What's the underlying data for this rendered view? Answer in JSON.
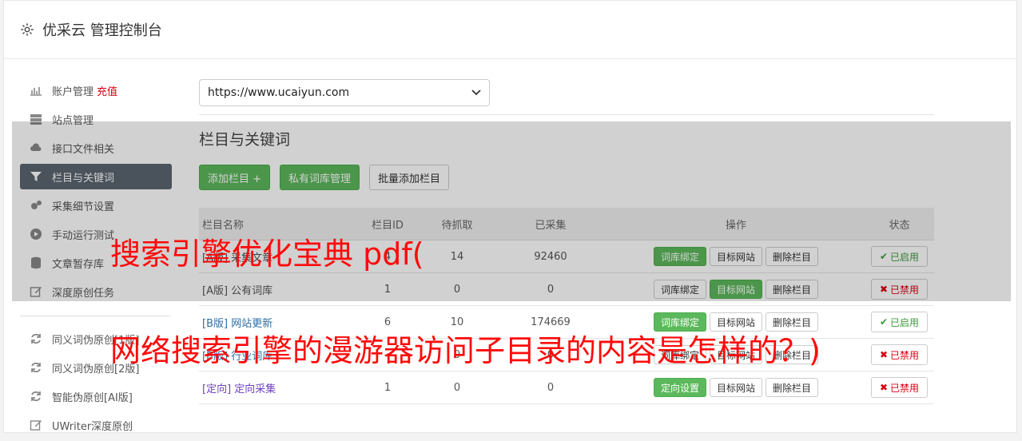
{
  "header": {
    "title": "优采云 管理控制台"
  },
  "sidebar": {
    "items": [
      {
        "label": "账户管理",
        "extra": "充值",
        "icon": "bar-chart-icon"
      },
      {
        "label": "站点管理",
        "icon": "server-icon"
      },
      {
        "label": "接口文件相关",
        "icon": "cloud-upload-icon"
      },
      {
        "label": "栏目与关键词",
        "icon": "filter-icon",
        "active": true
      },
      {
        "label": "采集细节设置",
        "icon": "cogs-icon"
      },
      {
        "label": "手动运行测试",
        "icon": "play-circle-icon"
      },
      {
        "label": "文章暂存库",
        "icon": "database-icon"
      },
      {
        "label": "深度原创任务",
        "icon": "edit-icon"
      }
    ],
    "items2": [
      {
        "label": "同义词伪原创[1版]",
        "icon": "refresh-icon"
      },
      {
        "label": "同义词伪原创[2版]",
        "icon": "refresh-icon"
      },
      {
        "label": "智能伪原创[AI版]",
        "icon": "refresh-icon"
      },
      {
        "label": "UWriter深度原创",
        "icon": "edit-icon"
      }
    ]
  },
  "main": {
    "site_select": "https://www.ucaiyun.com",
    "section_title": "栏目与关键词",
    "buttons": {
      "add": "添加栏目 +",
      "private": "私有词库管理",
      "batch": "批量添加栏目"
    },
    "columns": [
      "栏目名称",
      "栏目ID",
      "待抓取",
      "已采集",
      "操作",
      "状态"
    ],
    "rows": [
      {
        "name": "[A版] 采集文章",
        "id": "4",
        "pending": "14",
        "collected": "92460",
        "op1": "词库绑定",
        "op1_green": true,
        "op2": "目标网站",
        "op2_green": false,
        "op3": "删除栏目",
        "status": "已启用",
        "on": true,
        "name_color": "plain"
      },
      {
        "name": "[A版] 公有词库",
        "id": "1",
        "pending": "0",
        "collected": "0",
        "op1": "词库绑定",
        "op1_green": false,
        "op2": "目标网站",
        "op2_green": true,
        "op3": "删除栏目",
        "status": "已禁用",
        "on": false,
        "name_color": "plain"
      },
      {
        "name": "[B版] 网站更新",
        "id": "6",
        "pending": "10",
        "collected": "174669",
        "op1": "词库绑定",
        "op1_green": true,
        "op2": "目标网站",
        "op2_green": false,
        "op3": "删除栏目",
        "status": "已启用",
        "on": true,
        "name_color": "blue"
      },
      {
        "name": "[B版] 行业词库",
        "id": "",
        "pending": "0",
        "collected": "0",
        "op1": "词库绑定",
        "op1_green": false,
        "op2": "目标网站",
        "op2_green": false,
        "op3": "删除栏目",
        "status": "已禁用",
        "on": false,
        "name_color": "blue"
      },
      {
        "name": "[定向] 定向采集",
        "id": "1",
        "pending": "0",
        "collected": "0",
        "op1": "定向设置",
        "op1_green": true,
        "op2": "目标网站",
        "op2_green": false,
        "op3": "删除栏目",
        "status": "已禁用",
        "on": false,
        "name_color": "purple"
      }
    ]
  },
  "watermark": {
    "line1": "搜索引擎优化宝典 pdf(",
    "line2": "网络搜索引擎的漫游器访问子目录的内容是怎样的？)"
  },
  "colors": {
    "accent_green": "#5cb85c",
    "sidebar_active": "#5b6470",
    "watermark": "#ff0a0a"
  }
}
